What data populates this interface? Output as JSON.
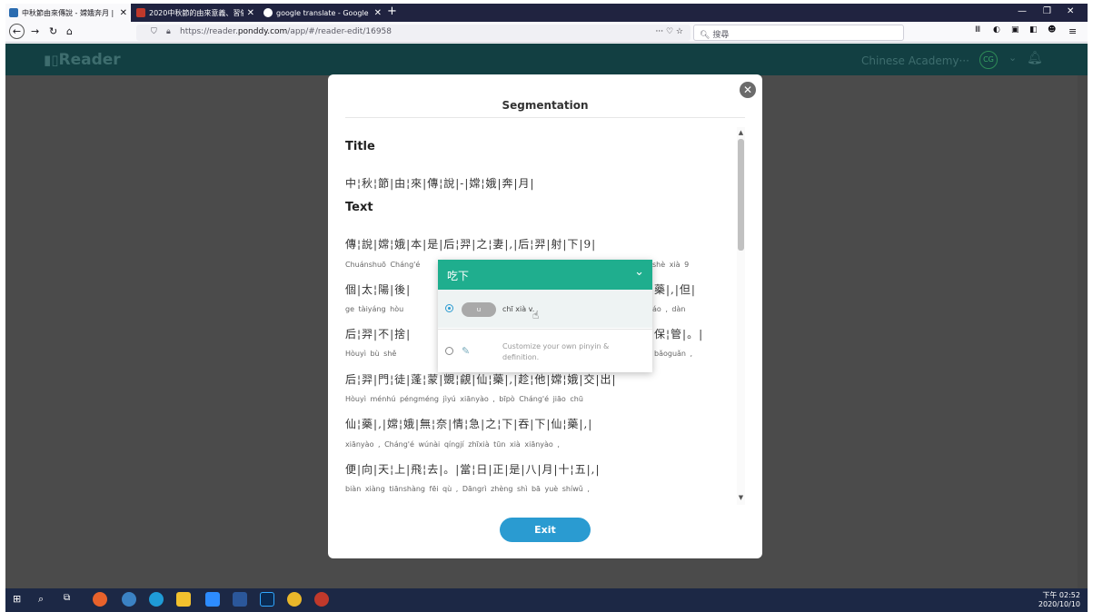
{
  "browser": {
    "tabs": [
      {
        "title": "中秋節由來傳說 - 嫦娥奔月 | P...",
        "active": true
      },
      {
        "title": "2020中秋節的由來意義、習俗...",
        "active": false
      },
      {
        "title": "google translate - Google 搜...",
        "active": false
      }
    ],
    "new_tab": "+",
    "url_scheme": "https://reader.",
    "url_domain": "ponddy.com",
    "url_path": "/app/#/reader-edit/16958",
    "search_placeholder": "搜尋",
    "page_actions": "··· ♡ ☆"
  },
  "app": {
    "logo": "Reader",
    "academy": "Chinese Academy···",
    "avatar": "CG"
  },
  "modal": {
    "title": "Segmentation",
    "section_title": "Title",
    "section_text": "Text",
    "title_hanzi": "中¦秋¦節|由¦來|傳¦說|-|嫦¦娥|奔|月|",
    "rows": [
      {
        "hanzi": "傳¦說|嫦¦娥|本|是|后¦羿|之¦妻|,|后¦羿|射|下|9|",
        "pinyin": "Chuánshuō Cháng'é"
      },
      {
        "hanzi": "個|太¦陽|後|",
        "pinyin": "ge    tàiyáng    hòu"
      },
      {
        "hanzi": "后¦羿|不|捨|",
        "pinyin": "Hòuyì    bù    shě"
      },
      {
        "hanzi": "后¦羿|門¦徒|蓬¦蒙|覬¦覦|仙¦藥|,|趁¦他|嫦¦娥|交|出|",
        "pinyin": "Hòuyì    ménhú    péngméng    jìyú    xiānyào    ,    bīpò    Cháng'é    jiāo chū"
      },
      {
        "hanzi": "仙¦藥|,|嫦¦娥|無¦奈|情¦急|之¦下|吞|下|仙¦藥|,|",
        "pinyin": "xiānyào    ,    Cháng'é    wúnài    qíngjí    zhīxià    tūn xià    xiānyào    ,"
      },
      {
        "hanzi": "便|向|天¦上|飛¦去|。|當¦日|正|是|八|月|十¦五|,|",
        "pinyin": "biàn  xiàng  tiānshàng  fēi qù   ,   Dāngrì   zhèng shì   bā   yuè   shíwǔ   ,"
      }
    ],
    "right_pinyin": [
      {
        "row": 0,
        "text": "shè xià    9"
      },
      {
        "row": 1,
        "text": "áo    ,    dàn"
      },
      {
        "row": 2,
        "text": "bǎoguǎn    ,"
      }
    ],
    "right_hanzi": [
      {
        "row": 1,
        "text": "藥|,|但|"
      },
      {
        "row": 2,
        "text": "保¦管|。|"
      }
    ],
    "exit_label": "Exit"
  },
  "popup": {
    "word": "吃下",
    "option1_toggle": "u",
    "option1_pinyin": "chī xià v.",
    "option2_text": "Customize your own pinyin & definition."
  },
  "taskbar": {
    "time": "下午 02:52",
    "date": "2020/10/10"
  }
}
